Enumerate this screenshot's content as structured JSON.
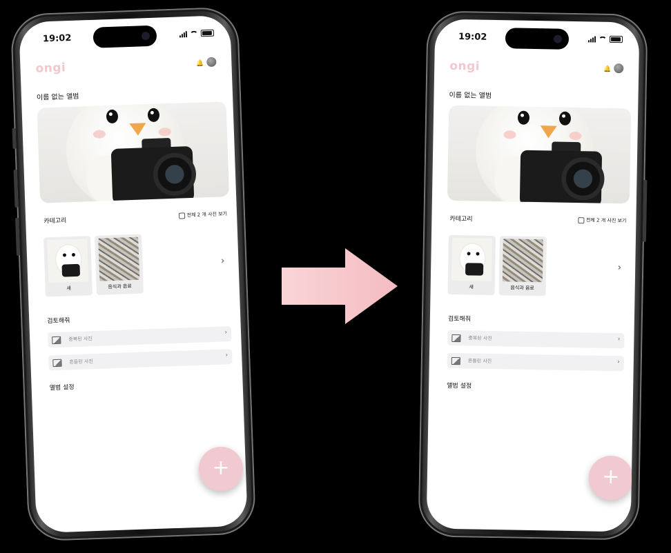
{
  "status": {
    "time": "19:02"
  },
  "app": {
    "logo": "ongi",
    "bell_icon": "bell-icon",
    "avatar": "avatar"
  },
  "album": {
    "title": "이름 없는 앨범"
  },
  "category": {
    "title": "카테고리",
    "view_all": "전체 2 개 사진 보기",
    "items": [
      {
        "label": "새"
      },
      {
        "label": "음식과 음료"
      }
    ]
  },
  "review": {
    "title": "검토해줘",
    "rows": [
      {
        "label": "중복된 사진"
      },
      {
        "label": "흔들린 사진"
      }
    ]
  },
  "settings": {
    "title": "앨범 설정"
  },
  "fab": {
    "label": "+"
  },
  "colors": {
    "accent": "#f1c9d0",
    "logo": "#f3c7ce",
    "arrow": "#f5c3c8"
  }
}
